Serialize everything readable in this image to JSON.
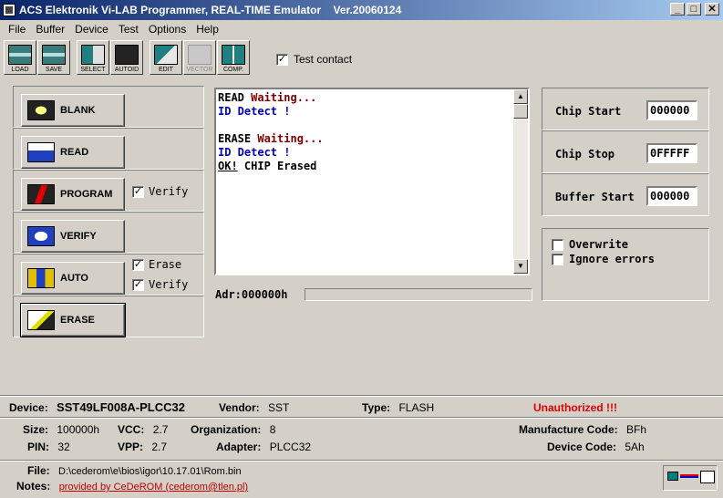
{
  "window": {
    "title": "ACS Elektronik Vi-LAB Programmer, REAL-TIME Emulator    Ver.20060124",
    "min": "_",
    "max": "□",
    "close": "✕"
  },
  "menu": [
    "File",
    "Buffer",
    "Device",
    "Test",
    "Options",
    "Help"
  ],
  "toolbar": {
    "load": "LOAD",
    "save": "SAVE",
    "select": "SELECT",
    "autoid": "AUTOID",
    "edit": "EDIT",
    "vector": "VECTOR",
    "comp": "COMP.",
    "test_contact": "Test contact",
    "test_contact_checked": true
  },
  "operations": {
    "blank": "BLANK",
    "read": "READ",
    "program": "PROGRAM",
    "verify": "VERIFY",
    "auto": "AUTO",
    "erase": "ERASE",
    "program_verify_label": "Verify",
    "auto_erase_label": "Erase",
    "auto_verify_label": "Verify",
    "check_mark": "✓"
  },
  "log": {
    "l1a": "READ ",
    "l1b": "Waiting...",
    "l2": "ID Detect !",
    "l3": "",
    "l4a": "ERASE ",
    "l4b": "Waiting...",
    "l5": "ID Detect !",
    "l6a": "OK!",
    "l6b": " CHIP Erased"
  },
  "address": {
    "label": "Adr:000000h",
    "progress": 0
  },
  "right": {
    "chip_start_label": "Chip Start",
    "chip_start": "000000",
    "chip_stop_label": "Chip Stop",
    "chip_stop": "0FFFFF",
    "buffer_start_label": "Buffer Start",
    "buffer_start": "000000",
    "overwrite": "Overwrite",
    "ignore_errors": "Ignore errors"
  },
  "device": {
    "device_label": "Device:",
    "device": "SST49LF008A-PLCC32",
    "vendor_label": "Vendor:",
    "vendor": "SST",
    "type_label": "Type:",
    "type": "FLASH",
    "status": "Unauthorized !!!",
    "size_label": "Size:",
    "size": "100000h",
    "vcc_label": "VCC:",
    "vcc": "2.7",
    "org_label": "Organization:",
    "org": "8",
    "manuf_label": "Manufacture Code:",
    "manuf": "BFh",
    "pin_label": "PIN:",
    "pin": "32",
    "vpp_label": "VPP:",
    "vpp": "2.7",
    "adapter_label": "Adapter:",
    "adapter": "PLCC32",
    "devcode_label": "Device Code:",
    "devcode": "5Ah"
  },
  "file": {
    "file_label": "File:",
    "file": "D:\\cederom\\e\\bios\\igor\\10.17.01\\Rom.bin",
    "notes_label": "Notes:",
    "notes": "provided by CeDeROM (cederom@tlen.pl)"
  }
}
